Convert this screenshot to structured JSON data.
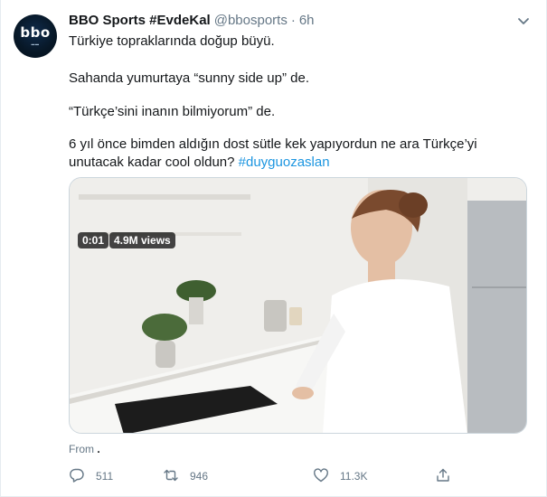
{
  "account": {
    "display_name": "BBO Sports #EvdeKal",
    "handle": "@bbosports",
    "separator": "·",
    "time": "6h",
    "avatar_text": "bbo"
  },
  "tweet": {
    "line1": "Türkiye topraklarında doğup büyü.",
    "line2": "Sahanda yumurtaya “sunny side up” de.",
    "line3": "“Türkçe’sini inanın bilmiyorum” de.",
    "line4": "6 yıl önce bimden aldığın dost sütle kek yapıyordun ne ara Türkçe’yi",
    "line5": "unutacak kadar cool oldun?",
    "hashtag": "#duyguozaslan"
  },
  "video": {
    "duration": "0:01",
    "views": "4.9M views"
  },
  "source": {
    "prefix": "From",
    "name": "."
  },
  "actions": {
    "reply_count": "511",
    "retweet_count": "946",
    "like_count": "11.3K"
  },
  "colors": {
    "accent": "#1b95e0",
    "secondary_text": "#657786",
    "primary_text": "#14171a"
  },
  "icons": [
    "chevron-down-icon",
    "reply-icon",
    "retweet-icon",
    "like-icon",
    "share-icon"
  ]
}
